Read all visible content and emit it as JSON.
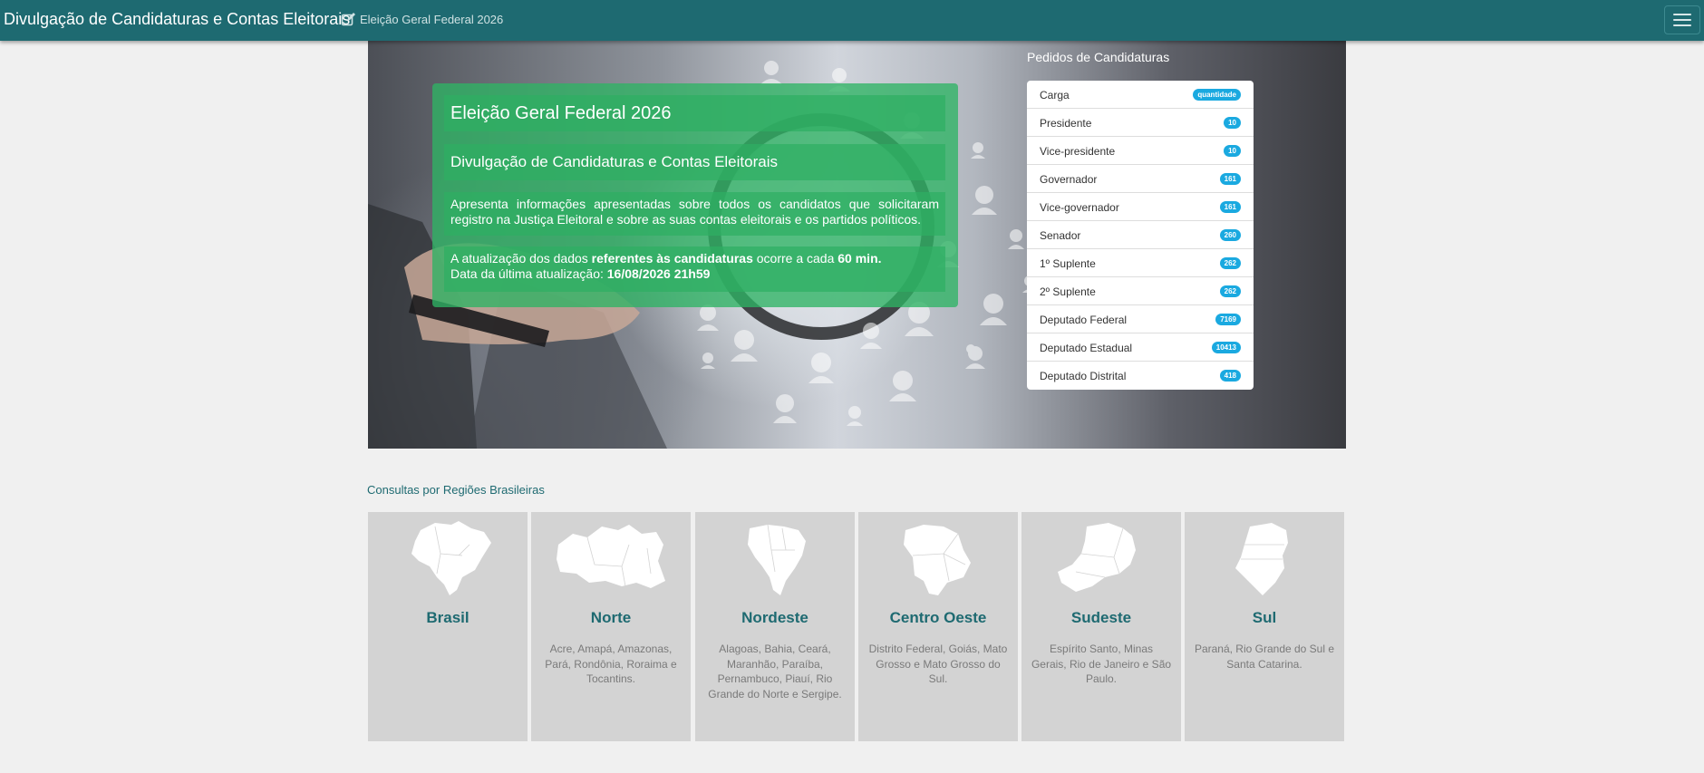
{
  "navbar": {
    "brand": "Divulgação de Candidaturas e Contas Eleitorais",
    "election_link": "Eleição Geral Federal 2026"
  },
  "hero": {
    "title": "Eleição Geral Federal 2026",
    "subtitle": "Divulgação de Candidaturas e Contas Eleitorais",
    "description": "Apresenta informações apresentadas sobre todos os candidatos que solicitaram registro na Justiça Eleitoral e sobre as suas contas eleitorais e os partidos políticos.",
    "update_prefix": "A atualização dos dados ",
    "update_bold": "referentes às candidaturas",
    "update_middle": " ocorre a cada ",
    "update_interval": "60 min.",
    "last_update_label": "Data da última atualização: ",
    "last_update_value": "16/08/2026 21h59"
  },
  "pedidos": {
    "title": "Pedidos de Candidaturas",
    "items": [
      {
        "label": "Carga",
        "badge": "quantidade"
      },
      {
        "label": "Presidente",
        "badge": "10"
      },
      {
        "label": "Vice-presidente",
        "badge": "10"
      },
      {
        "label": "Governador",
        "badge": "161"
      },
      {
        "label": "Vice-governador",
        "badge": "161"
      },
      {
        "label": "Senador",
        "badge": "260"
      },
      {
        "label": "1º Suplente",
        "badge": "262"
      },
      {
        "label": "2º Suplente",
        "badge": "262"
      },
      {
        "label": "Deputado Federal",
        "badge": "7169"
      },
      {
        "label": "Deputado Estadual",
        "badge": "10413"
      },
      {
        "label": "Deputado Distrital",
        "badge": "418"
      }
    ]
  },
  "regions": {
    "title": "Consultas por Regiões Brasileiras",
    "items": [
      {
        "name": "Brasil",
        "states": ""
      },
      {
        "name": "Norte",
        "states": "Acre, Amapá, Amazonas, Pará, Rondônia, Roraima e Tocantins."
      },
      {
        "name": "Nordeste",
        "states": "Alagoas, Bahia, Ceará, Maranhão, Paraíba, Pernambuco, Piauí, Rio Grande do Norte e Sergipe."
      },
      {
        "name": "Centro Oeste",
        "states": "Distrito Federal, Goiás, Mato Grosso e Mato Grosso do Sul."
      },
      {
        "name": "Sudeste",
        "states": "Espírito Santo, Minas Gerais, Rio de Janeiro e São Paulo."
      },
      {
        "name": "Sul",
        "states": "Paraná, Rio Grande do Sul e Santa Catarina."
      }
    ]
  },
  "icons": {
    "edit": "edit-icon",
    "menu": "hamburger-menu-icon",
    "maps": [
      "brazil-map-icon",
      "norte-map-icon",
      "nordeste-map-icon",
      "centro-oeste-map-icon",
      "sudeste-map-icon",
      "sul-map-icon"
    ]
  },
  "colors": {
    "navbar": "#1e6a71",
    "info_box": "#2eb464",
    "badge": "#1aa9e0",
    "region_card": "#d3d3d3",
    "region_title": "#1e6a71"
  }
}
